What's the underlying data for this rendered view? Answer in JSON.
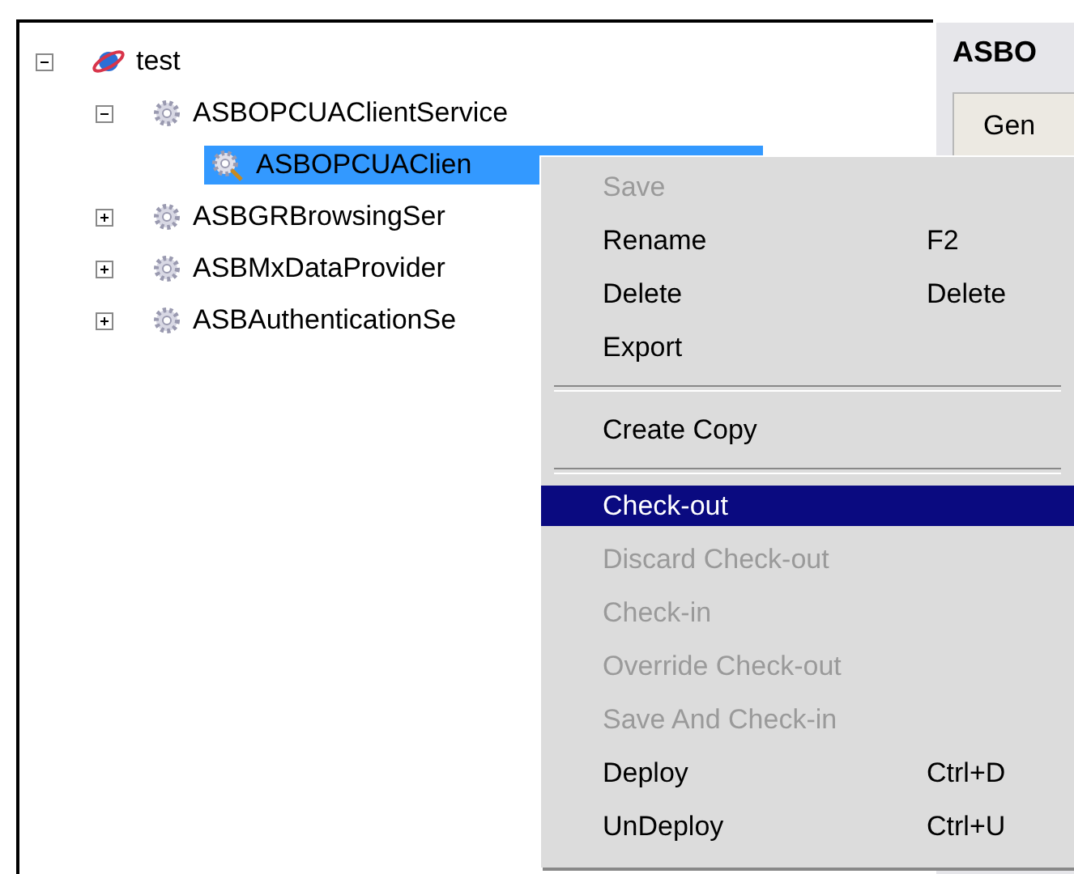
{
  "tree": [
    {
      "label": "test",
      "expanded": true,
      "selected": false,
      "children": [
        {
          "label": "ASBOPCUAClientService",
          "expanded": true,
          "selected": false,
          "children": [
            {
              "label": "ASBOPCUAClien",
              "selected": true
            }
          ]
        },
        {
          "label": "ASBGRBrowsingSer",
          "expanded": false,
          "selected": false
        },
        {
          "label": "ASBMxDataProvider",
          "expanded": false,
          "selected": false
        },
        {
          "label": "ASBAuthenticationSe",
          "expanded": false,
          "selected": false
        }
      ]
    }
  ],
  "detail": {
    "title": "ASBO",
    "tab": "Gen"
  },
  "context_menu": [
    {
      "kind": "item",
      "label": "Save",
      "disabled": true,
      "selected": false
    },
    {
      "kind": "item",
      "label": "Rename",
      "shortcut": "F2",
      "disabled": false,
      "selected": false
    },
    {
      "kind": "item",
      "label": "Delete",
      "shortcut": "Delete",
      "disabled": false,
      "selected": false
    },
    {
      "kind": "item",
      "label": "Export",
      "disabled": false,
      "selected": false
    },
    {
      "kind": "separator"
    },
    {
      "kind": "item",
      "label": "Create Copy",
      "disabled": false,
      "selected": false
    },
    {
      "kind": "separator"
    },
    {
      "kind": "item",
      "label": "Check-out",
      "disabled": false,
      "selected": true
    },
    {
      "kind": "item",
      "label": "Discard Check-out",
      "disabled": true,
      "selected": false
    },
    {
      "kind": "item",
      "label": "Check-in",
      "disabled": true,
      "selected": false
    },
    {
      "kind": "item",
      "label": "Override Check-out",
      "disabled": true,
      "selected": false
    },
    {
      "kind": "item",
      "label": "Save And Check-in",
      "disabled": true,
      "selected": false
    },
    {
      "kind": "item",
      "label": "Deploy",
      "shortcut": "Ctrl+D",
      "disabled": false,
      "selected": false
    },
    {
      "kind": "item",
      "label": "UnDeploy",
      "shortcut": "Ctrl+U",
      "disabled": false,
      "selected": false
    }
  ]
}
